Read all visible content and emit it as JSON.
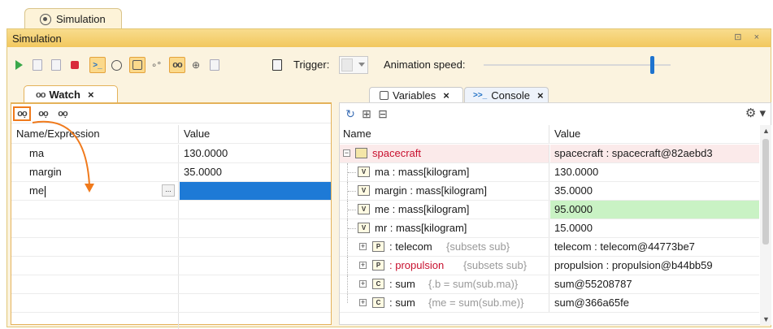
{
  "outer_tab": {
    "label": "Simulation"
  },
  "panel": {
    "title": "Simulation",
    "window_controls": "⊡ ×"
  },
  "toolbar": {
    "trigger_label": "Trigger:",
    "animation_speed_label": "Animation speed:",
    "animation_speed_level": 0.9
  },
  "watch": {
    "tab_label": "Watch",
    "tab_close": "×",
    "tool_icons": [
      "add-watch-icon",
      "remove-watch-icon",
      "remove-all-watch-icon"
    ],
    "columns": [
      "Name/Expression",
      "Value"
    ],
    "rows": [
      {
        "name": "ma",
        "value": "130.0000"
      },
      {
        "name": "margin",
        "value": "35.0000"
      },
      {
        "name": "me",
        "value": ""
      }
    ],
    "edit_button": "..."
  },
  "variables": {
    "tab_label": "Variables",
    "console_tab_label": "Console",
    "tab_close": "×",
    "columns": [
      "Name",
      "Value"
    ],
    "rows": [
      {
        "name": "spacecraft",
        "suffix": "",
        "value": "spacecraft : spacecraft@82aebd3"
      },
      {
        "badge": "V",
        "name": "ma : mass[kilogram]",
        "suffix": "",
        "value": "130.0000"
      },
      {
        "badge": "V",
        "name": "margin : mass[kilogram]",
        "suffix": "",
        "value": "35.0000"
      },
      {
        "badge": "V",
        "name": "me : mass[kilogram]",
        "suffix": "",
        "value": "95.0000"
      },
      {
        "badge": "V",
        "name": "mr : mass[kilogram]",
        "suffix": "",
        "value": "15.0000"
      },
      {
        "badge": "P",
        "name": ": telecom",
        "suffix": "{subsets sub}",
        "value": "telecom : telecom@44773be7"
      },
      {
        "badge": "P",
        "name": ": propulsion",
        "suffix": "{subsets sub}",
        "value": "propulsion : propulsion@b44bb59"
      },
      {
        "badge": "C",
        "name": ": sum",
        "suffix": "{.b = sum(sub.ma)}",
        "value": "sum@55208787"
      },
      {
        "badge": "C",
        "name": ": sum",
        "suffix": "{me = sum(sub.me)}",
        "value": "sum@366a65fe"
      }
    ]
  },
  "colors": {
    "accent": "#f07a1c",
    "selection": "#1e7ad6",
    "changed_value": "#c9f2c4",
    "panel_header": "#f2c85e"
  }
}
